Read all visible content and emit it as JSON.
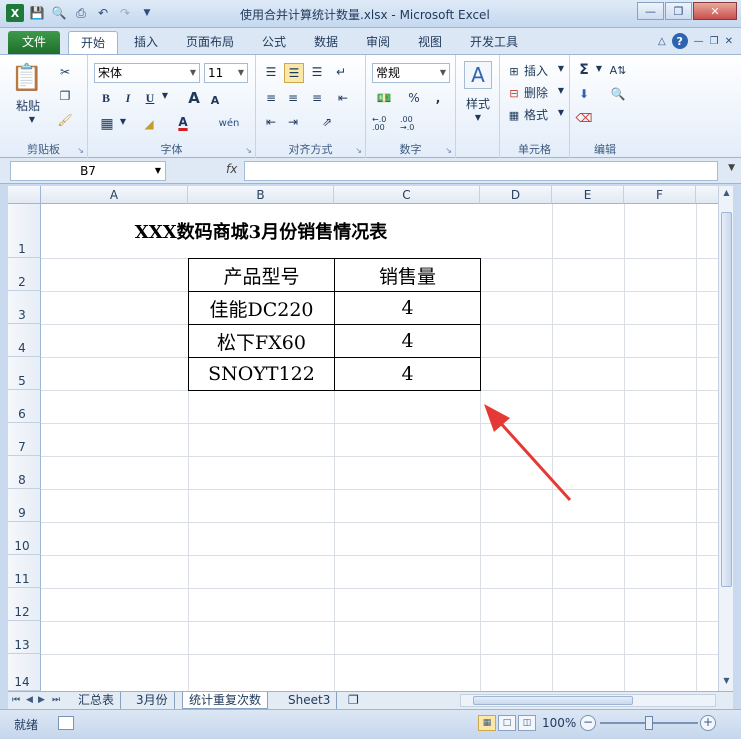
{
  "window": {
    "title": "使用合并计算统计数量.xlsx - Microsoft Excel"
  },
  "ribbon_tabs": [
    "文件",
    "开始",
    "插入",
    "页面布局",
    "公式",
    "数据",
    "审阅",
    "视图",
    "开发工具"
  ],
  "ribbon": {
    "clipboard": {
      "paste_label": "粘贴",
      "group_label": "剪贴板"
    },
    "font": {
      "font_name": "宋体",
      "font_size": "11",
      "group_label": "字体",
      "bold": "B",
      "italic": "I",
      "underline": "U",
      "grow": "A",
      "shrink": "A",
      "font_color": "A"
    },
    "alignment": {
      "group_label": "对齐方式"
    },
    "number": {
      "format": "常规",
      "percent": "%",
      "comma": ",",
      "inc_decimal": "←.0 .00",
      "dec_decimal": ".00 →.0",
      "group_label": "数字"
    },
    "styles": {
      "label": "样式"
    },
    "cells": {
      "insert": "插入",
      "delete": "删除",
      "format": "格式",
      "group_label": "单元格"
    },
    "editing": {
      "group_label": "编辑",
      "sum": "Σ"
    }
  },
  "formula_bar": {
    "name_box": "B7",
    "fx": "fx",
    "value": ""
  },
  "columns": [
    "A",
    "B",
    "C",
    "D",
    "E",
    "F"
  ],
  "rows": [
    "1",
    "2",
    "3",
    "4",
    "5",
    "6",
    "7",
    "8",
    "9",
    "10",
    "11",
    "12",
    "13",
    "14"
  ],
  "sheet": {
    "title": "XXX数码商城3月份销售情况表",
    "table": {
      "headers": [
        "产品型号",
        "销售量"
      ],
      "rows": [
        [
          "佳能DC220",
          "4"
        ],
        [
          "松下FX60",
          "4"
        ],
        [
          "SNOYT122",
          "4"
        ]
      ]
    }
  },
  "sheet_tabs": [
    "汇总表",
    "3月份",
    "统计重复次数",
    "Sheet3"
  ],
  "active_sheet_tab": "统计重复次数",
  "status_bar": {
    "ready": "就绪",
    "zoom": "100%"
  },
  "colors": {
    "arrow": "#e53935",
    "file_tab": "#2a7f37",
    "excel_green": "#1d7a3a"
  }
}
